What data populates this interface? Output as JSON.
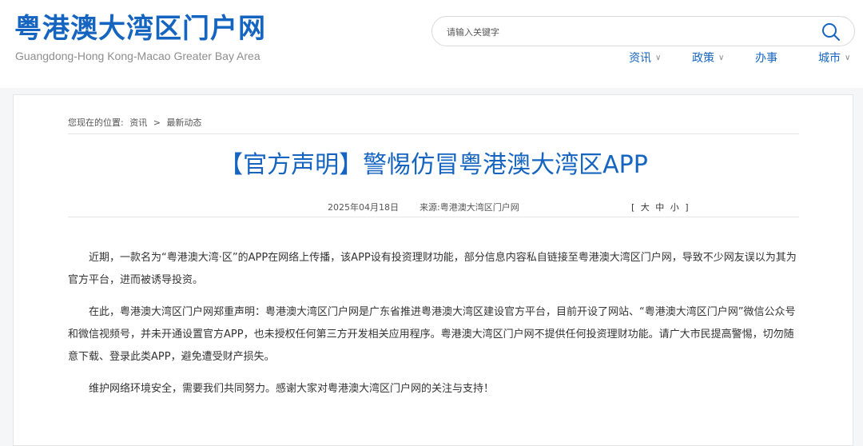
{
  "header": {
    "logo_title": "粤港澳大湾区门户网",
    "logo_subtitle": "Guangdong-Hong Kong-Macao Greater Bay Area",
    "search": {
      "placeholder": "请输入关键字"
    },
    "nav": [
      {
        "label": "资讯",
        "has_dropdown": true
      },
      {
        "label": "政策",
        "has_dropdown": true
      },
      {
        "label": "办事",
        "has_dropdown": false
      },
      {
        "label": "城市",
        "has_dropdown": true
      }
    ],
    "nav_chevron": "∨"
  },
  "breadcrumb": {
    "prefix": "您现在的位置:",
    "items": [
      "资讯",
      "最新动态"
    ],
    "separator": ">"
  },
  "article": {
    "title": "【官方声明】警惕仿冒粤港澳大湾区APP",
    "date": "2025年04月18日",
    "source": "来源:粤港澳大湾区门户网",
    "font_size": {
      "open": "[",
      "large": "大",
      "medium": "中",
      "small": "小",
      "close": "]"
    },
    "paragraphs": [
      "近期，一款名为“粤港澳大湾·区”的APP在网络上传播，该APP设有投资理财功能，部分信息内容私自链接至粤港澳大湾区门户网，导致不少网友误以为其为官方平台，进而被诱导投资。",
      "在此，粤港澳大湾区门户网郑重声明：粤港澳大湾区门户网是广东省推进粤港澳大湾区建设官方平台，目前开设了网站、“粤港澳大湾区门户网”微信公众号和微信视频号，并未开通设置官方APP，也未授权任何第三方开发相关应用程序。粤港澳大湾区门户网不提供任何投资理财功能。请广大市民提高警惕，切勿随意下载、登录此类APP，避免遭受财产损失。",
      "维护网络环境安全，需要我们共同努力。感谢大家对粤港澳大湾区门户网的关注与支持！"
    ]
  },
  "colors": {
    "brand": "#1565c0",
    "text": "#333333",
    "muted": "#8e8e8e"
  }
}
